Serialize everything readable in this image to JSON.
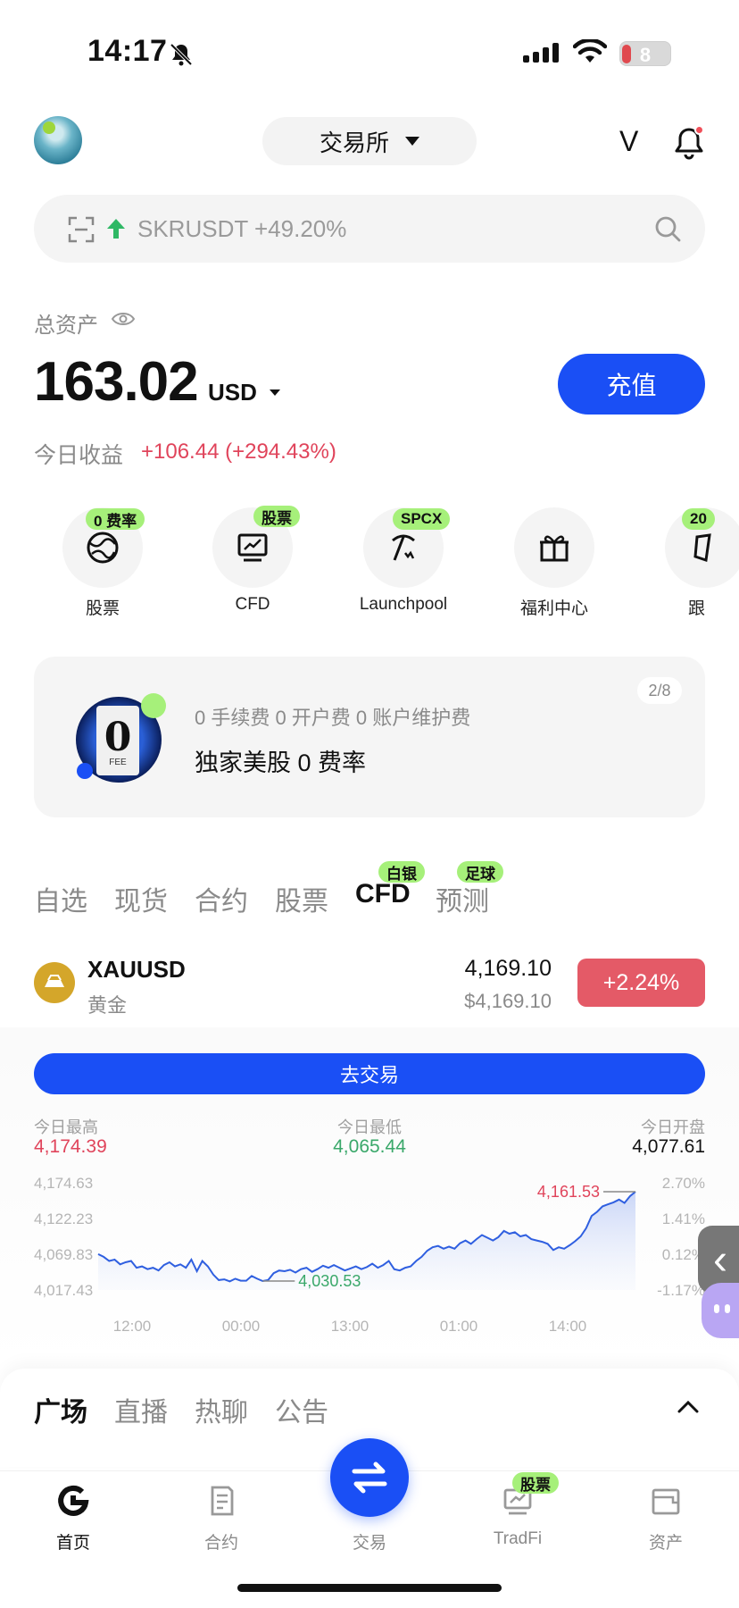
{
  "status_bar": {
    "time": "14:17",
    "battery": "8"
  },
  "header": {
    "exchange_label": "交易所",
    "logo_text": "V"
  },
  "search": {
    "trending": "SKRUSDT +49.20%"
  },
  "assets": {
    "label": "总资产",
    "value": "163.02",
    "unit": "USD",
    "deposit_label": "充值",
    "pnl_label": "今日收益",
    "pnl_value": "+106.44 (+294.43%)"
  },
  "shortcuts": [
    {
      "badge": "0 费率",
      "label": "股票",
      "icon": "globe-icon"
    },
    {
      "badge": "股票",
      "label": "CFD",
      "icon": "chart-board-icon"
    },
    {
      "badge": "SPCX",
      "label": "Launchpool",
      "icon": "pickaxe-icon"
    },
    {
      "badge": "",
      "label": "福利中心",
      "icon": "gift-icon"
    },
    {
      "badge": "20",
      "label": "跟",
      "icon": "copy-trade-icon"
    }
  ],
  "banner": {
    "subtitle": "0 手续费 0 开户费 0 账户维护费",
    "title": "独家美股 0 费率",
    "page": "2/8",
    "image_text": "0",
    "image_caption": "FEE"
  },
  "market_tabs": [
    {
      "label": "自选",
      "badge": ""
    },
    {
      "label": "现货",
      "badge": ""
    },
    {
      "label": "合约",
      "badge": ""
    },
    {
      "label": "股票",
      "badge": ""
    },
    {
      "label": "CFD",
      "badge": "白银",
      "active": true
    },
    {
      "label": "预测",
      "badge": "足球"
    }
  ],
  "instrument": {
    "symbol": "XAUUSD",
    "name": "黄金",
    "price": "4,169.10",
    "price_usd": "$4,169.10",
    "change": "+2.24%",
    "trade_label": "去交易",
    "stats": [
      {
        "label": "今日最高",
        "value": "4,174.39",
        "color": "#e0445b"
      },
      {
        "label": "今日最低",
        "value": "4,065.44",
        "color": "#3aa86a"
      },
      {
        "label": "今日开盘",
        "value": "4,077.61",
        "color": "#111111"
      }
    ]
  },
  "chart_data": {
    "type": "area",
    "x_ticks": [
      "12:00",
      "00:00",
      "13:00",
      "01:00",
      "14:00"
    ],
    "y_ticks_left": [
      "4,174.63",
      "4,122.23",
      "4,069.83",
      "4,017.43"
    ],
    "y_ticks_right": [
      "2.70%",
      "1.41%",
      "0.12%",
      "-1.17%"
    ],
    "ylim": [
      4017.43,
      4174.63
    ],
    "annotations": [
      {
        "label": "4,161.53",
        "value": 4161.53,
        "kind": "high"
      },
      {
        "label": "4,030.53",
        "value": 4030.53,
        "kind": "low"
      }
    ],
    "values": [
      4070,
      4066,
      4060,
      4062,
      4055,
      4058,
      4060,
      4050,
      4052,
      4048,
      4050,
      4046,
      4054,
      4058,
      4052,
      4055,
      4050,
      4062,
      4045,
      4060,
      4052,
      4040,
      4032,
      4033,
      4030,
      4034,
      4031,
      4031,
      4038,
      4034,
      4030.5,
      4032,
      4042,
      4046,
      4045,
      4047,
      4043,
      4048,
      4050,
      4044,
      4048,
      4053,
      4050,
      4054,
      4050,
      4046,
      4049,
      4052,
      4048,
      4051,
      4056,
      4050,
      4054,
      4060,
      4048,
      4046,
      4050,
      4052,
      4060,
      4066,
      4075,
      4080,
      4082,
      4078,
      4081,
      4078,
      4086,
      4090,
      4085,
      4092,
      4098,
      4094,
      4090,
      4095,
      4104,
      4100,
      4102,
      4096,
      4098,
      4092,
      4090,
      4088,
      4085,
      4076,
      4080,
      4078,
      4083,
      4089,
      4096,
      4108,
      4126,
      4132,
      4140,
      4143,
      4146,
      4150,
      4145,
      4155,
      4161.53
    ]
  },
  "community_tabs": [
    {
      "label": "广场",
      "active": true
    },
    {
      "label": "直播"
    },
    {
      "label": "热聊"
    },
    {
      "label": "公告"
    }
  ],
  "bottom_nav": {
    "home": "首页",
    "futures": "合约",
    "trade": "交易",
    "tradfi": "TradFi",
    "tradfi_badge": "股票",
    "assets": "资产"
  },
  "colors": {
    "brand": "#1a4ff5",
    "up": "#e0445b",
    "down": "#3aa86a",
    "badge": "#a6f07a"
  }
}
